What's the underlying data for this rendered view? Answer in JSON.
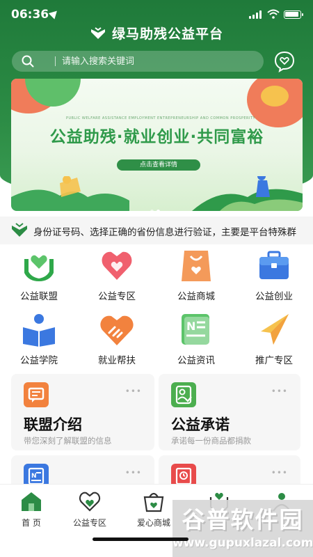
{
  "status_bar": {
    "time": "06:36"
  },
  "app": {
    "title": "绿马助残公益平台"
  },
  "search": {
    "placeholder": "请输入搜索关键词"
  },
  "banner": {
    "subtitle": "PUBLIC WELFARE ASSISTANCE EMPLOYMENT ENTREPRENEURSHIP AND COMMON PROSPERITY",
    "title": "公益助残·就业创业·共同富裕",
    "cta": "点击查看详情",
    "active_dot": 2,
    "dot_count": 2
  },
  "notice": {
    "text": "身份证号码、选择正确的省份信息进行验证，主要是平台特殊群"
  },
  "grid": [
    {
      "label": "公益联盟",
      "icon": "hands-heart-icon"
    },
    {
      "label": "公益专区",
      "icon": "heart-icon"
    },
    {
      "label": "公益商城",
      "icon": "shopping-bag-icon"
    },
    {
      "label": "公益创业",
      "icon": "briefcase-icon"
    },
    {
      "label": "公益学院",
      "icon": "book-reader-icon"
    },
    {
      "label": "就业帮扶",
      "icon": "handshake-icon"
    },
    {
      "label": "公益资讯",
      "icon": "news-icon"
    },
    {
      "label": "推广专区",
      "icon": "paper-plane-icon"
    }
  ],
  "cards": [
    {
      "title": "联盟介绍",
      "subtitle": "带您深刻了解联盟的信息",
      "icon": "message-icon",
      "color": "#f2823e"
    },
    {
      "title": "公益承诺",
      "subtitle": "承诺每一份商品都捐款",
      "icon": "user-check-icon",
      "color": "#4cae4f"
    },
    {
      "title": "",
      "subtitle": "",
      "icon": "news-icon",
      "color": "#3b78e0"
    },
    {
      "title": "",
      "subtitle": "",
      "icon": "clock-doc-icon",
      "color": "#e84b4b"
    }
  ],
  "card_more": "•••",
  "tabbar": [
    {
      "label": "首 页",
      "icon": "home-icon"
    },
    {
      "label": "公益专区",
      "icon": "heart-icon"
    },
    {
      "label": "爱心商城",
      "icon": "basket-icon"
    },
    {
      "label": "",
      "icon": "heart-hands-icon"
    },
    {
      "label": "",
      "icon": "user-icon"
    }
  ],
  "watermark": {
    "title": "谷普软件园",
    "url": "www.gupuxlazal.com"
  },
  "colors": {
    "primary": "#2c8c45",
    "banner_title": "#2f9a4a",
    "muted": "#9a9a9a"
  }
}
